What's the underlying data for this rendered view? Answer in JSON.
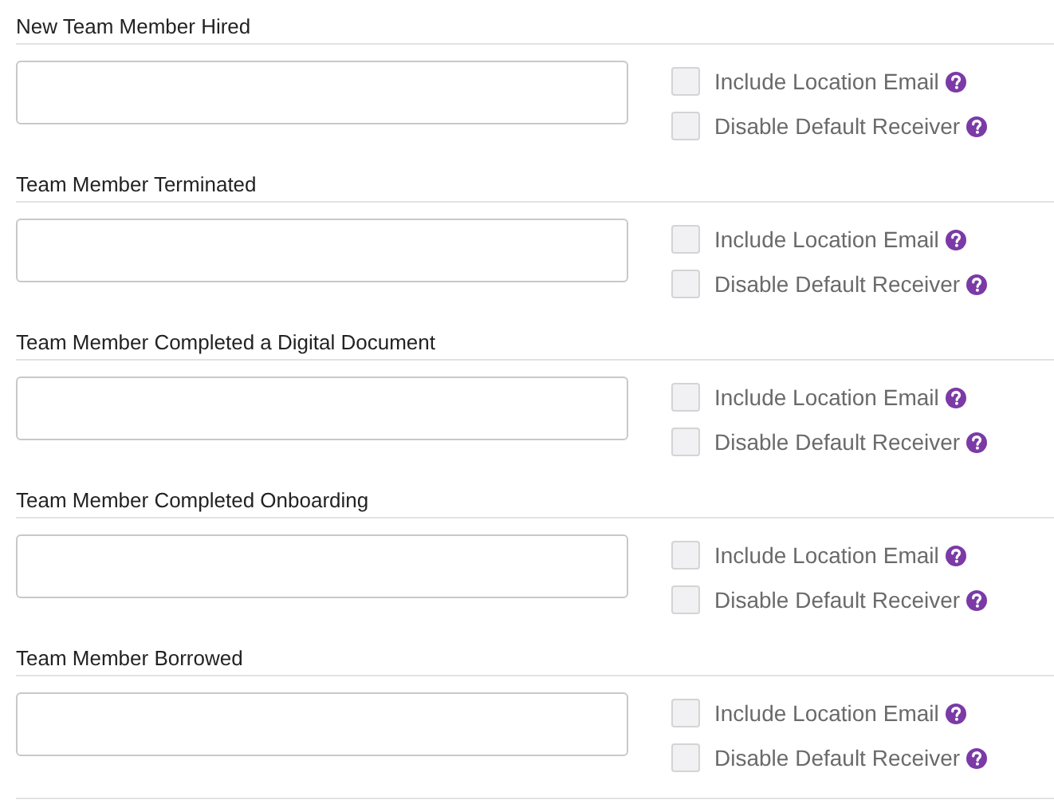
{
  "sections": [
    {
      "title": "New Team Member Hired",
      "options": [
        {
          "label": "Include Location Email",
          "checked": false
        },
        {
          "label": "Disable Default Receiver",
          "checked": false
        }
      ]
    },
    {
      "title": "Team Member Terminated",
      "options": [
        {
          "label": "Include Location Email",
          "checked": false
        },
        {
          "label": "Disable Default Receiver",
          "checked": false
        }
      ]
    },
    {
      "title": "Team Member Completed a Digital Document",
      "options": [
        {
          "label": "Include Location Email",
          "checked": false
        },
        {
          "label": "Disable Default Receiver",
          "checked": false
        }
      ]
    },
    {
      "title": "Team Member Completed Onboarding",
      "options": [
        {
          "label": "Include Location Email",
          "checked": false
        },
        {
          "label": "Disable Default Receiver",
          "checked": false
        }
      ]
    },
    {
      "title": "Team Member Borrowed",
      "options": [
        {
          "label": "Include Location Email",
          "checked": false
        },
        {
          "label": "Disable Default Receiver",
          "checked": false
        }
      ]
    }
  ]
}
